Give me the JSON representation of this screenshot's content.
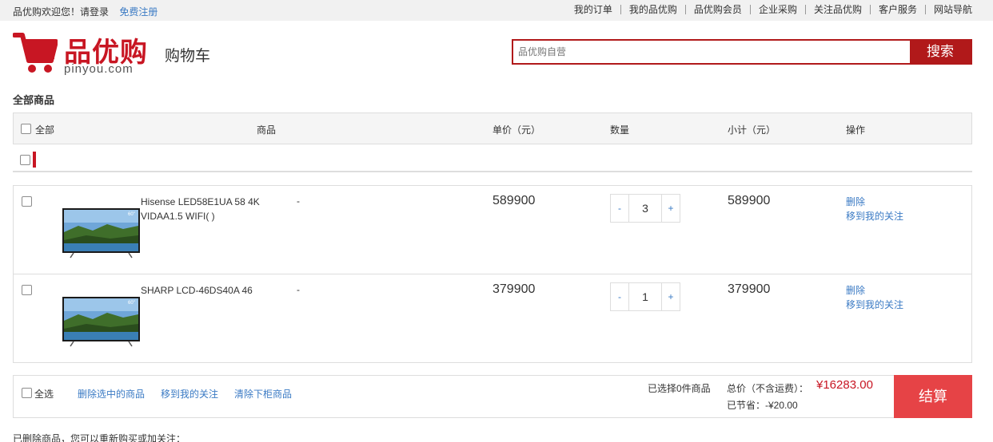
{
  "topbar": {
    "welcome": "品优购欢迎您！请登录",
    "register": "免费注册",
    "links": [
      "我的订单",
      "我的品优购",
      "品优购会员",
      "企业采购",
      "关注品优购",
      "客户服务",
      "网站导航"
    ]
  },
  "header": {
    "brand": "品优购",
    "domain": "pinyou.com",
    "page_name": "购物车",
    "search_placeholder": "品优购自营",
    "search_button": "搜索"
  },
  "cart": {
    "title": "全部商品",
    "columns": {
      "select_all": "全部",
      "product": "商品",
      "unit_price": "单价（元）",
      "quantity": "数量",
      "subtotal": "小计（元）",
      "actions": "操作"
    },
    "items": [
      {
        "name": "Hisense LED58E1UA 58 4K VIDAA1.5 WIFI( )",
        "spec": "-",
        "price": "589900",
        "qty": "3",
        "subtotal": "589900",
        "delete": "删除",
        "move": "移到我的关注"
      },
      {
        "name": "SHARP LCD-46DS40A 46",
        "spec": "-",
        "price": "379900",
        "qty": "1",
        "subtotal": "379900",
        "delete": "删除",
        "move": "移到我的关注"
      }
    ],
    "stepper": {
      "minus": "-",
      "plus": "+"
    }
  },
  "footer": {
    "select_all": "全选",
    "delete_selected": "删除选中的商品",
    "move_to_favs": "移到我的关注",
    "clear": "清除下柜商品",
    "chosen": "已选择0件商品",
    "total_label": "总价（不含运费）：",
    "total": "¥16283.00",
    "saved": "已节省：-¥20.00",
    "checkout": "结算"
  },
  "deleted_note": "已删除商品，您可以重新购买或加关注：",
  "colors": {
    "brand": "#c81623",
    "checkout": "#e64346",
    "link": "#3a7ac4"
  }
}
